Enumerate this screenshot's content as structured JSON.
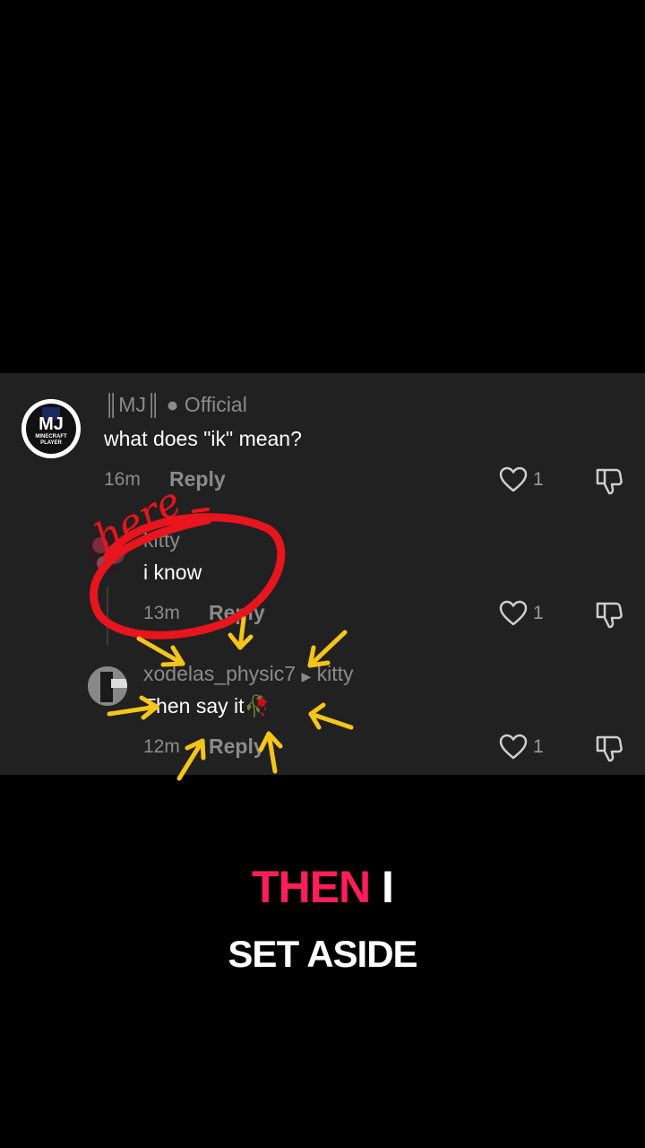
{
  "comments": [
    {
      "user_prefix": "║MJ║",
      "user_badge": "● Official",
      "text": "what does \"ik\" mean?",
      "time": "16m",
      "reply": "Reply",
      "likes": "1",
      "avatar_text_top": "MJ",
      "avatar_text_bottom": "MINECRAFT PLAYER"
    },
    {
      "username": "kitty",
      "text": "i know",
      "time": "13m",
      "reply": "Reply",
      "likes": "1"
    },
    {
      "username": "xodelas_physic7",
      "reply_to": "kitty",
      "text": "Then say it🥀",
      "time": "12m",
      "reply": "Reply",
      "likes": "1"
    }
  ],
  "annotation": {
    "handwritten": "here"
  },
  "caption": {
    "highlight": "THEN",
    "word": "I",
    "line2": "SET ASIDE"
  },
  "colors": {
    "highlight": "#ff1e5a",
    "annotation_red": "#e8141e",
    "arrow": "#f5c518"
  }
}
